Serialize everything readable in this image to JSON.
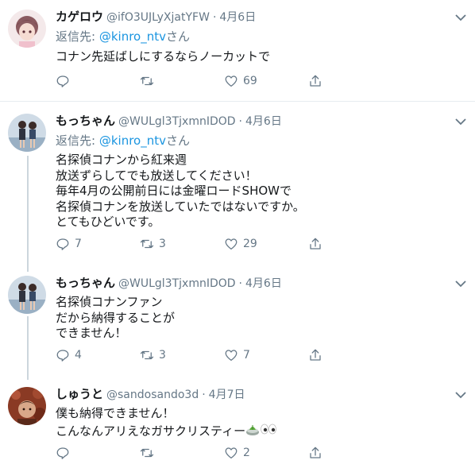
{
  "reply_prefix": "返信先:",
  "reply_suffix": "さん",
  "tweets": [
    {
      "name": "カゲロウ",
      "handle": "@ifO3UJLyXjatYFW",
      "date": "4月6日",
      "reply_to": "@kinro_ntv",
      "lines": [
        "コナン先延ばしにするならノーカットで"
      ],
      "replies": "",
      "retweets": "",
      "likes": "69"
    },
    {
      "name": "もっちゃん",
      "handle": "@WULgl3TjxmnIDOD",
      "date": "4月6日",
      "reply_to": "@kinro_ntv",
      "lines": [
        "名探偵コナンから紅来週",
        "放送ずらしてでも放送してください！",
        "毎年4月の公開前日には金曜ロードSHOWで",
        "名探偵コナンを放送していたではないですか。",
        "とてもひどいです。"
      ],
      "replies": "7",
      "retweets": "3",
      "likes": "29"
    },
    {
      "name": "もっちゃん",
      "handle": "@WULgl3TjxmnIDOD",
      "date": "4月6日",
      "lines": [
        "名探偵コナンファン",
        "だから納得することが",
        "できません！"
      ],
      "replies": "4",
      "retweets": "3",
      "likes": "7"
    },
    {
      "name": "しゅうと",
      "handle": "@sandosando3d",
      "date": "4月7日",
      "lines": [
        "僕も納得できません！",
        "こんなんアリえなガサクリスティー"
      ],
      "replies": "",
      "retweets": "",
      "likes": "2"
    }
  ],
  "dot": "·",
  "colors": {
    "text": "#14171a",
    "secondary": "#657786",
    "link": "#1b95e0",
    "separator": "#e6ecf0",
    "thread_line": "#ccd6dd"
  },
  "icons": [
    "chevron-down-icon",
    "reply-icon",
    "retweet-icon",
    "like-icon",
    "share-icon",
    "plant-emoji-icon",
    "eyes-emoji-icon"
  ]
}
